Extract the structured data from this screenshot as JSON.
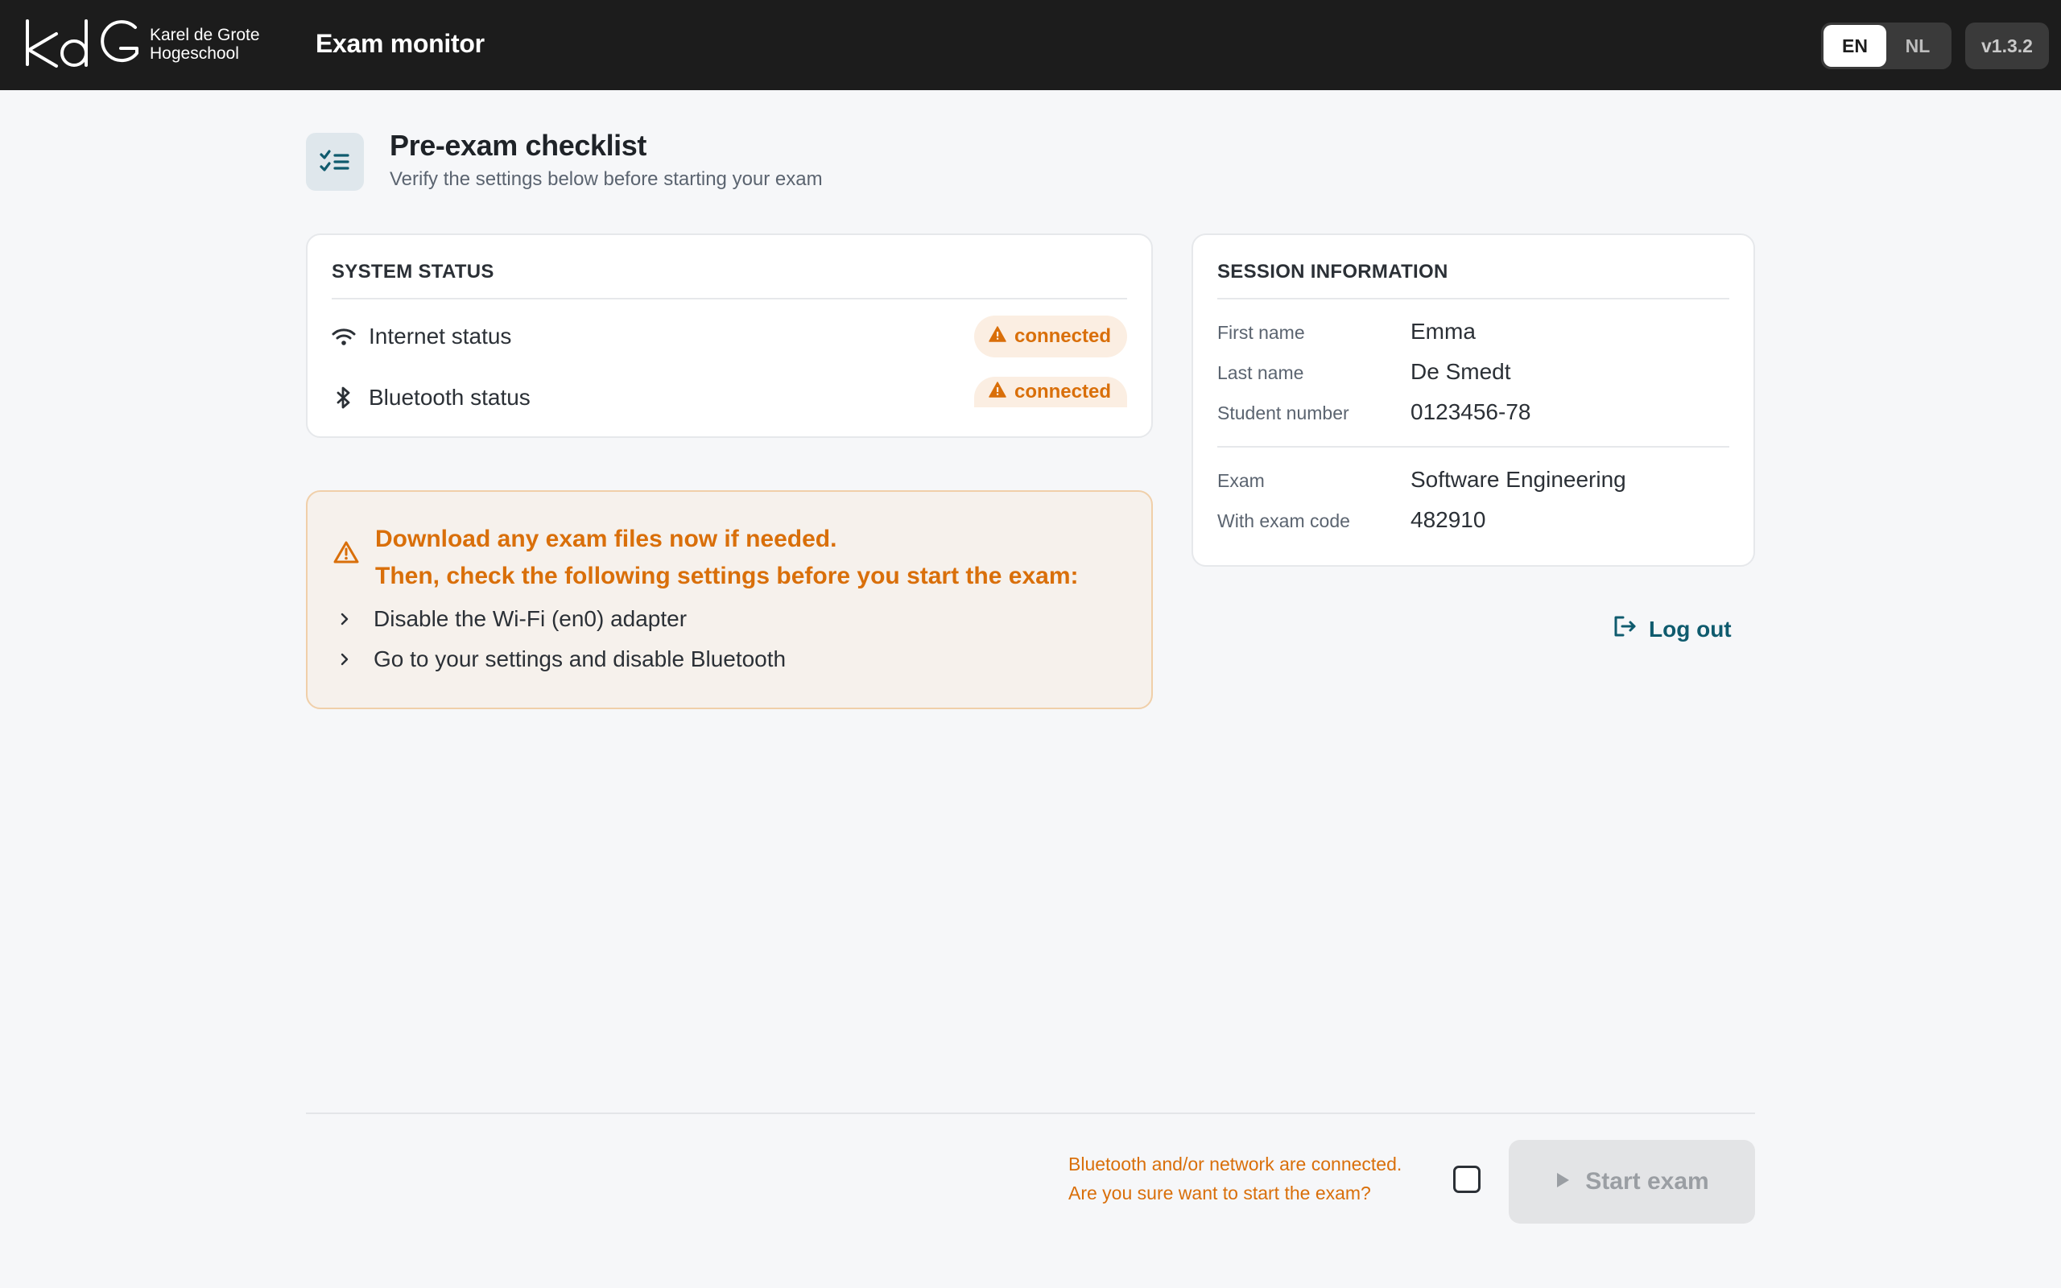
{
  "header": {
    "logo_line1": "Karel de Grote",
    "logo_line2": "Hogeschool",
    "app_title": "Exam monitor",
    "languages": [
      {
        "label": "EN",
        "active": true
      },
      {
        "label": "NL",
        "active": false
      }
    ],
    "version": "v1.3.2"
  },
  "page": {
    "title": "Pre-exam checklist",
    "subtitle": "Verify the settings below before starting your exam",
    "icon": "checklist-icon"
  },
  "system_status": {
    "title": "SYSTEM STATUS",
    "rows": [
      {
        "label": "Internet status",
        "icon": "wifi-icon",
        "status": "connected"
      },
      {
        "label": "Bluetooth status",
        "icon": "bluetooth-icon",
        "status": "connected"
      }
    ]
  },
  "warning": {
    "line1": "Download any exam files now if needed.",
    "line2": "Then, check the following settings before you start the exam:",
    "items": [
      "Disable the Wi-Fi (en0) adapter",
      "Go to your settings and disable Bluetooth"
    ]
  },
  "session": {
    "title": "SESSION INFORMATION",
    "first_name_label": "First name",
    "first_name": "Emma",
    "last_name_label": "Last name",
    "last_name": "De Smedt",
    "student_number_label": "Student number",
    "student_number": "0123456-78",
    "exam_label": "Exam",
    "exam": "Software Engineering",
    "exam_code_label": "With exam code",
    "exam_code": "482910"
  },
  "logout_label": "Log out",
  "footer": {
    "warning_line1": "Bluetooth and/or network are connected.",
    "warning_line2": "Are you sure want to start the exam?",
    "confirm_checked": false,
    "start_label": "Start exam"
  },
  "colors": {
    "warning": "#d96f0a",
    "accent": "#0f5b6e",
    "header_bg": "#1c1c1c"
  }
}
